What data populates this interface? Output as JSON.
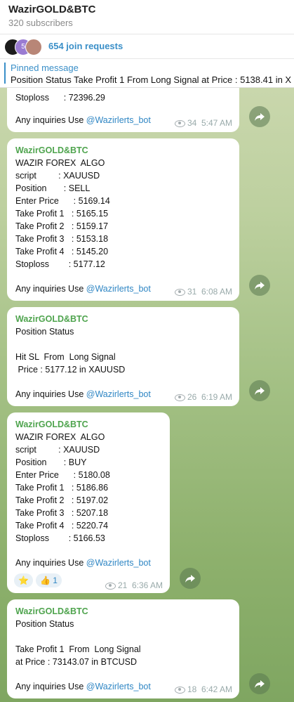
{
  "header": {
    "title": "WazirGOLD&BTC",
    "subtitle": "320 subscribers"
  },
  "join_requests": {
    "avatar_badge": "5",
    "label": "654 join requests"
  },
  "pinned": {
    "title": "Pinned message",
    "text": "Position Status  Take Profit 1  From  Long Signal at Price : 5138.41 in X"
  },
  "messages": [
    {
      "lines": [
        "Stoploss      : 72396.29"
      ],
      "inquiry": "Any inquiries Use ",
      "bot": "@Wazirlerts_bot",
      "views": "34",
      "time": "5:47 AM"
    },
    {
      "sender": "WazirGOLD&BTC",
      "lines": [
        "WAZIR FOREX  ALGO",
        "script         : XAUUSD",
        "Position       : SELL",
        "Enter Price      : 5169.14",
        "Take Profit 1   : 5165.15",
        "Take Profit 2   : 5159.17",
        "Take Profit 3   : 5153.18",
        "Take Profit 4   : 5145.20",
        "Stoploss        : 5177.12"
      ],
      "inquiry": "Any inquiries Use ",
      "bot": "@Wazirlerts_bot",
      "views": "31",
      "time": "6:08 AM"
    },
    {
      "sender": "WazirGOLD&BTC",
      "lines": [
        "Position Status",
        "",
        "Hit SL  From  Long Signal",
        " Price : 5177.12 in XAUUSD"
      ],
      "inquiry": "Any inquiries Use ",
      "bot": "@Wazirlerts_bot",
      "views": "26",
      "time": "6:19 AM"
    },
    {
      "sender": "WazirGOLD&BTC",
      "lines": [
        "WAZIR FOREX  ALGO",
        "script         : XAUUSD",
        "Position       : BUY",
        "Enter Price      : 5180.08",
        "Take Profit 1   : 5186.86",
        "Take Profit 2   : 5197.02",
        "Take Profit 3   : 5207.18",
        "Take Profit 4   : 5220.74",
        "Stoploss        : 5166.53"
      ],
      "inquiry": "Any inquiries Use ",
      "bot": "@Wazirlerts_bot",
      "reactions": [
        {
          "emoji": "⭐",
          "count": ""
        },
        {
          "emoji": "👍",
          "count": "1"
        }
      ],
      "views": "21",
      "time": "6:36 AM"
    },
    {
      "sender": "WazirGOLD&BTC",
      "lines": [
        "Position Status",
        "",
        "Take Profit 1  From  Long Signal",
        "at Price : 73143.07 in BTCUSD"
      ],
      "inquiry": "Any inquiries Use ",
      "bot": "@Wazirlerts_bot",
      "views": "18",
      "time": "6:42 AM"
    }
  ]
}
